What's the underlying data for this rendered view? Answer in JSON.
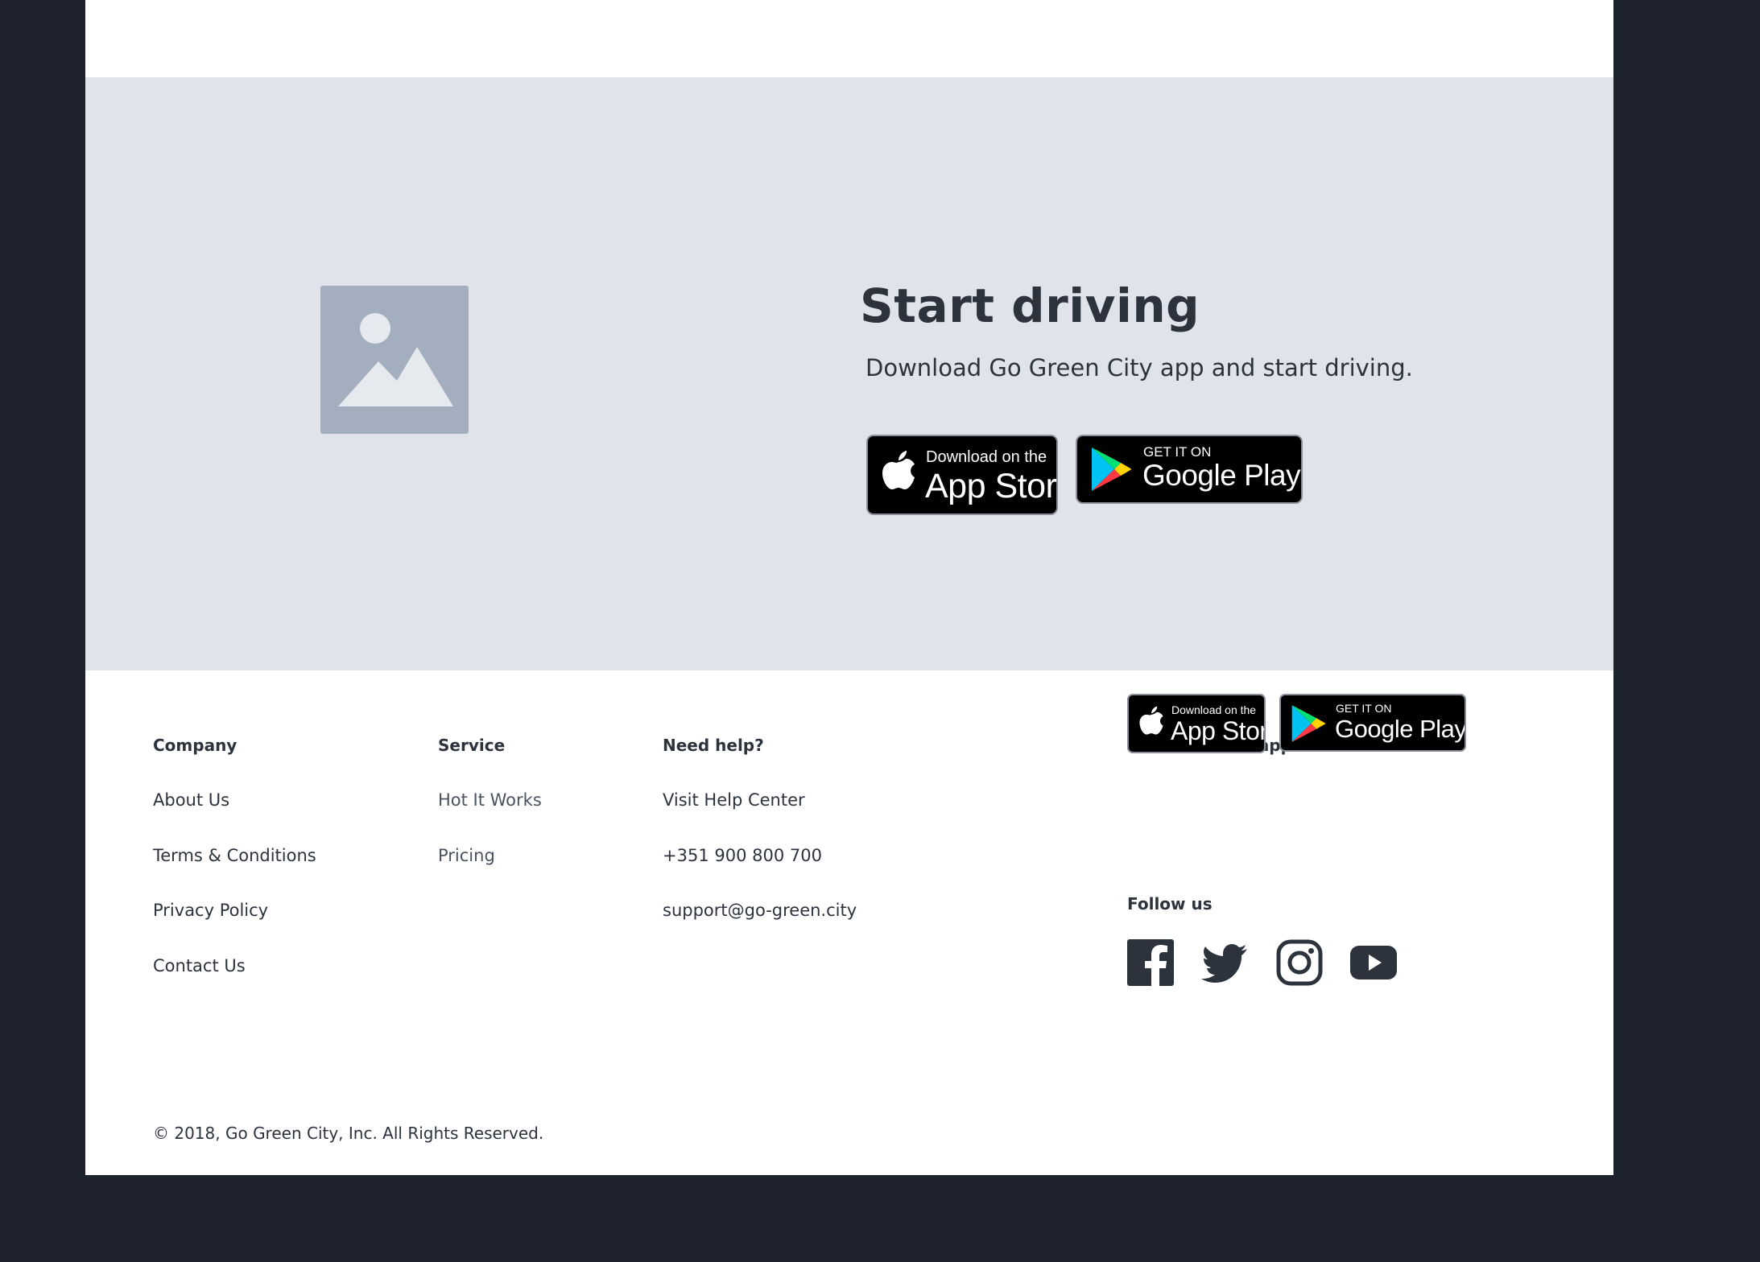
{
  "cta": {
    "title": "Start driving",
    "subtitle": "Download Go Green City app and start driving.",
    "image_icon": "image-placeholder-icon",
    "app_store": {
      "small": "Download on the",
      "big": "App Store"
    },
    "google_play": {
      "small": "GET IT ON",
      "big": "Google Play"
    }
  },
  "footer": {
    "company": {
      "heading": "Company",
      "links": [
        "About Us",
        "Terms & Conditions",
        "Privacy Policy",
        "Contact Us"
      ]
    },
    "service": {
      "heading": "Service",
      "links": [
        "Hot It Works",
        "Pricing"
      ]
    },
    "help": {
      "heading": "Need help?",
      "links": [
        "Visit Help Center",
        "+351 900 800 700",
        "support@go-green.city"
      ]
    },
    "download": {
      "heading": "Download the app",
      "app_store": {
        "small": "Download on the",
        "big": "App Store"
      },
      "google_play": {
        "small": "GET IT ON",
        "big": "Google Play"
      }
    },
    "follow": {
      "heading": "Follow us",
      "icons": [
        "facebook-icon",
        "twitter-icon",
        "instagram-icon",
        "youtube-icon"
      ]
    },
    "copyright": "© 2018, Go Green City, Inc. All Rights Reserved."
  },
  "colors": {
    "background": "#1e222c",
    "page": "#ffffff",
    "cta_band": "#e0e4ea",
    "placeholder": "#a3afbe",
    "text": "#2c333d",
    "badge": "#000000"
  }
}
